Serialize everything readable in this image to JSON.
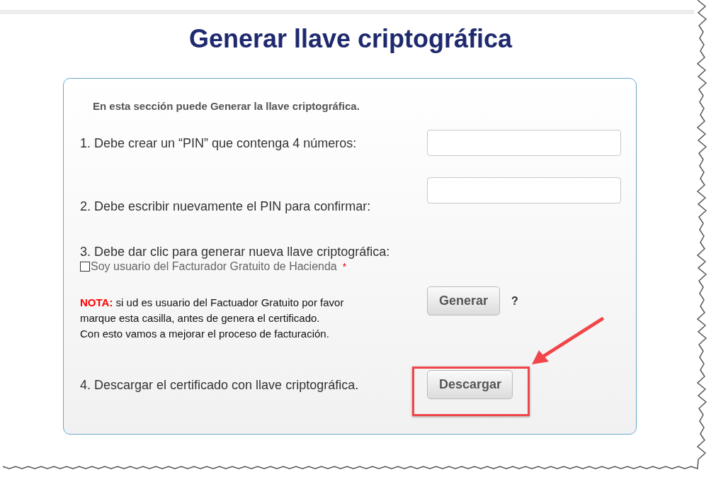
{
  "title": "Generar llave criptográfica",
  "card": {
    "intro": "En esta sección puede Generar la llave criptográfica.",
    "steps": [
      {
        "kind": "field",
        "label": "1. Debe crear un “PIN” que contenga 4 números:"
      },
      {
        "kind": "field",
        "label": "2. Debe escribir nuevamente el PIN para confirmar:"
      },
      {
        "kind": "generate",
        "label": "3. Debe dar clic para generar nueva llave criptográfica:",
        "checkbox": {
          "label": "Soy usuario del Facturador Gratuito de Hacienda",
          "checked": false,
          "required_mark": "*"
        },
        "note": {
          "label": "NOTA:",
          "lines": [
            "si ud es usuario del Factuador Gratuito por favor",
            "marque esta casilla, antes de genera el certificado.",
            "Con esto vamos a mejorar el proceso de facturación."
          ]
        },
        "button": "Generar",
        "help": "?"
      },
      {
        "kind": "download",
        "label": "4. Descargar el certificado con llave criptográfica.",
        "button": "Descargar",
        "highlighted": true
      }
    ]
  }
}
